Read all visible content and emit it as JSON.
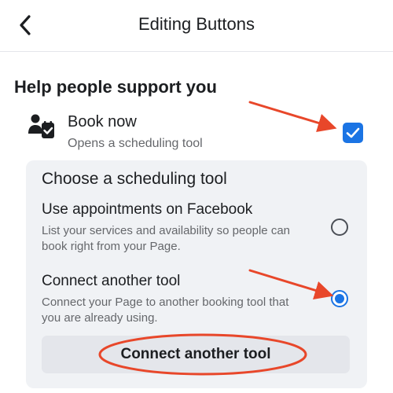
{
  "header": {
    "title": "Editing Buttons",
    "back_icon": "chevron-left-icon"
  },
  "section": {
    "title": "Help people support you"
  },
  "book_now": {
    "title": "Book now",
    "subtitle": "Opens a scheduling tool",
    "icon": "person-calendar-icon",
    "checked": true
  },
  "scheduling": {
    "title": "Choose a scheduling tool",
    "options": [
      {
        "title": "Use appointments on Facebook",
        "description": "List your services and availability so people can book right from your Page.",
        "selected": false
      },
      {
        "title": "Connect another tool",
        "description": "Connect your Page to another booking tool that you are already using.",
        "selected": true
      }
    ],
    "connect_button_label": "Connect another tool"
  },
  "colors": {
    "accent": "#1b74e4",
    "annotation": "#e8472a"
  }
}
